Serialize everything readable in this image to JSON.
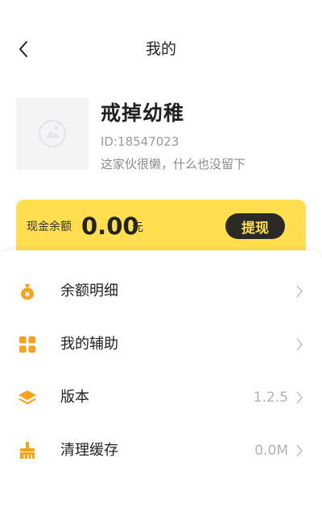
{
  "header": {
    "title": "我的",
    "back_icon": "back-chevron-icon"
  },
  "profile": {
    "nickname": "戒掉幼稚",
    "user_id": "ID:18547023",
    "signature": "这家伙很懒，什么也没留下",
    "avatar_icon": "default-avatar-icon"
  },
  "wallet": {
    "label": "现金余额",
    "amount": "0.00",
    "unit": "元",
    "withdraw_label": "提现",
    "background": "#ffdf4f",
    "button_background": "#2c2a27"
  },
  "menu": {
    "accent_color": "#f7a21b",
    "items": [
      {
        "label": "余额明细",
        "value": "",
        "icon": "money-bag-icon"
      },
      {
        "label": "我的辅助",
        "value": "",
        "icon": "grid-apps-icon"
      },
      {
        "label": "版本",
        "value": "1.2.5",
        "icon": "layers-icon"
      },
      {
        "label": "清理缓存",
        "value": "0.0M",
        "icon": "broom-icon"
      }
    ]
  }
}
